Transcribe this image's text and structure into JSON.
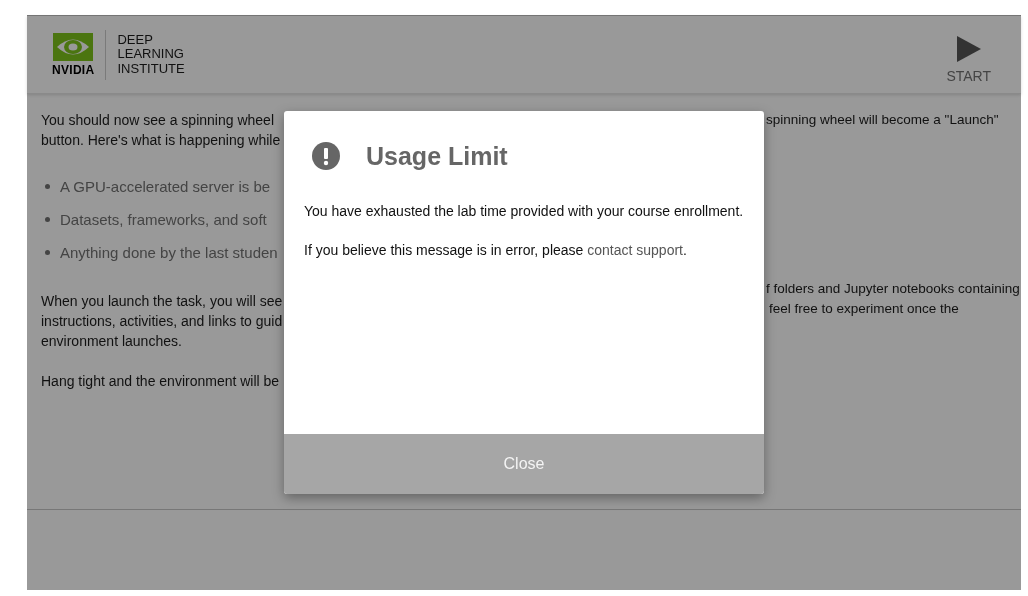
{
  "header": {
    "logo_wordmark": "NVIDIA",
    "institute_lines": [
      "DEEP",
      "LEARNING",
      "INSTITUTE"
    ],
    "start_button": {
      "label": "START"
    }
  },
  "background_text": {
    "left": {
      "intro": [
        "You should now see a spinning wheel",
        "button. Here's what is happening while"
      ],
      "bullets": [
        "A GPU-accelerated server is be",
        "Datasets, frameworks, and soft",
        "Anything done by the last studen"
      ],
      "launch": [
        "When you launch the task, you will see",
        "instructions, activities, and links to guid",
        "environment launches."
      ],
      "closing": "Hang tight and the environment will be"
    },
    "right": {
      "intro": "spinning wheel will become a \"Launch\"",
      "launch": [
        "f folders and Jupyter notebooks containing",
        "feel free to experiment once the"
      ]
    }
  },
  "dialog": {
    "title": "Usage Limit",
    "message": "You have exhausted the lab time provided with your course enrollment.",
    "note": "If you believe this message is in error, please ",
    "link": "contact support",
    "note_end": ".",
    "close_button": "Close"
  }
}
